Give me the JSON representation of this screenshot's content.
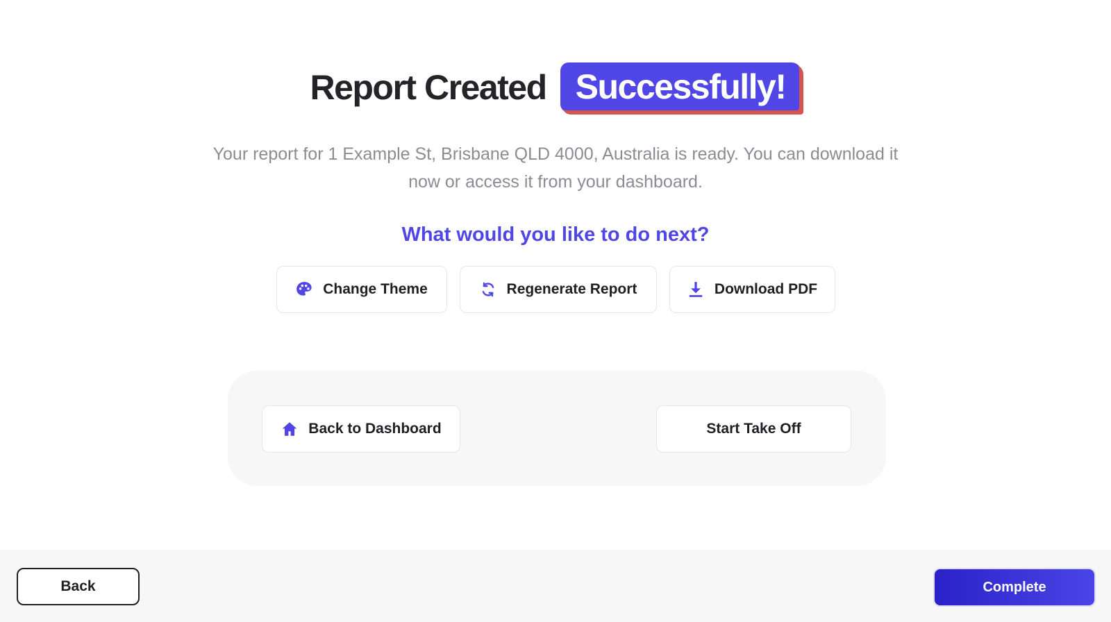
{
  "heading": {
    "main": "Report Created",
    "highlight": "Successfully!"
  },
  "subtext": "Your report for 1 Example St, Brisbane QLD 4000, Australia is ready. You can download it now or access it from your dashboard.",
  "next_title": "What would you like to do next?",
  "actions": {
    "change_theme": {
      "label": "Change Theme",
      "icon": "palette-icon"
    },
    "regenerate": {
      "label": "Regenerate Report",
      "icon": "refresh-icon"
    },
    "download": {
      "label": "Download PDF",
      "icon": "download-icon"
    }
  },
  "panel": {
    "dashboard": {
      "label": "Back to Dashboard",
      "icon": "home-icon"
    },
    "takeoff": {
      "label": "Start Take Off"
    }
  },
  "footer": {
    "back_label": "Back",
    "complete_label": "Complete"
  },
  "colors": {
    "accent": "#4f46e5",
    "pill_border": "#d9534f",
    "subtext": "#8b8b93",
    "panel_bg": "#f7f7f8"
  }
}
